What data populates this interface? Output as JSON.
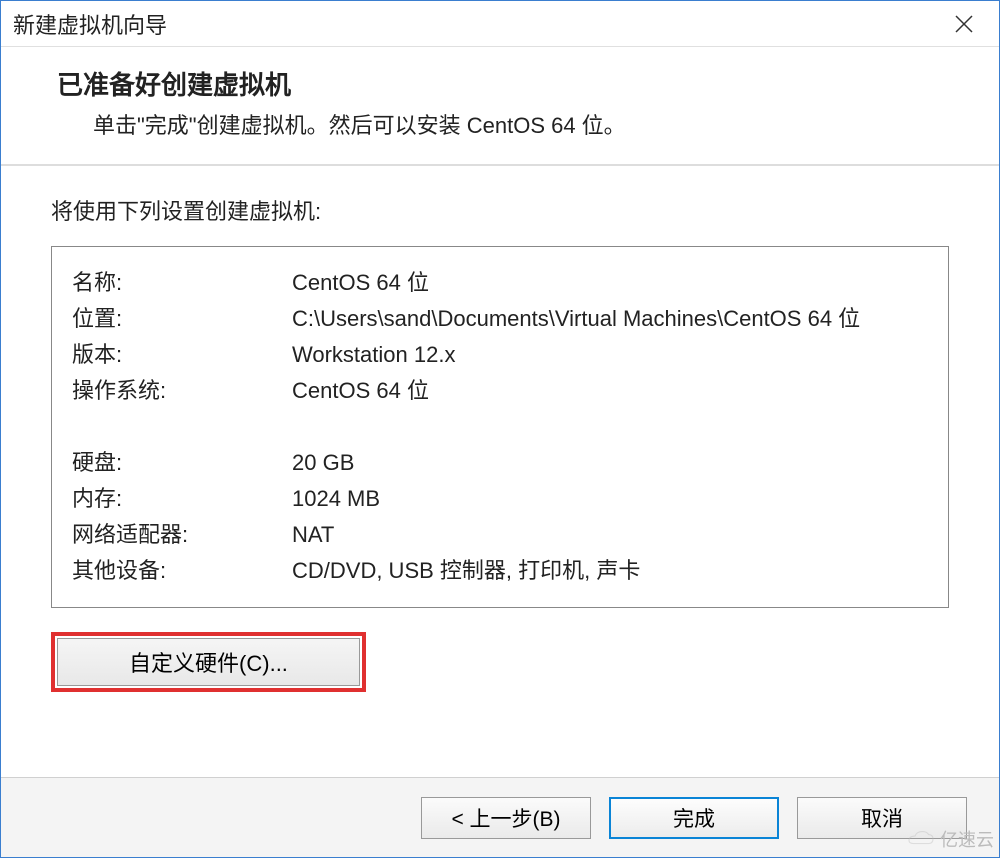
{
  "window": {
    "title": "新建虚拟机向导"
  },
  "header": {
    "title": "已准备好创建虚拟机",
    "subtitle": "单击\"完成\"创建虚拟机。然后可以安装 CentOS 64 位。"
  },
  "settings": {
    "label": "将使用下列设置创建虚拟机:",
    "rows": [
      {
        "key": "名称:",
        "value": "CentOS 64 位"
      },
      {
        "key": "位置:",
        "value": "C:\\Users\\sand\\Documents\\Virtual Machines\\CentOS 64 位"
      },
      {
        "key": "版本:",
        "value": "Workstation 12.x"
      },
      {
        "key": "操作系统:",
        "value": "CentOS 64 位"
      }
    ],
    "rows2": [
      {
        "key": "硬盘:",
        "value": "20 GB"
      },
      {
        "key": "内存:",
        "value": "1024 MB"
      },
      {
        "key": "网络适配器:",
        "value": "NAT"
      },
      {
        "key": "其他设备:",
        "value": "CD/DVD, USB 控制器, 打印机, 声卡"
      }
    ]
  },
  "buttons": {
    "customize": "自定义硬件(C)...",
    "back": "< 上一步(B)",
    "finish": "完成",
    "cancel": "取消"
  },
  "watermark": "亿速云"
}
